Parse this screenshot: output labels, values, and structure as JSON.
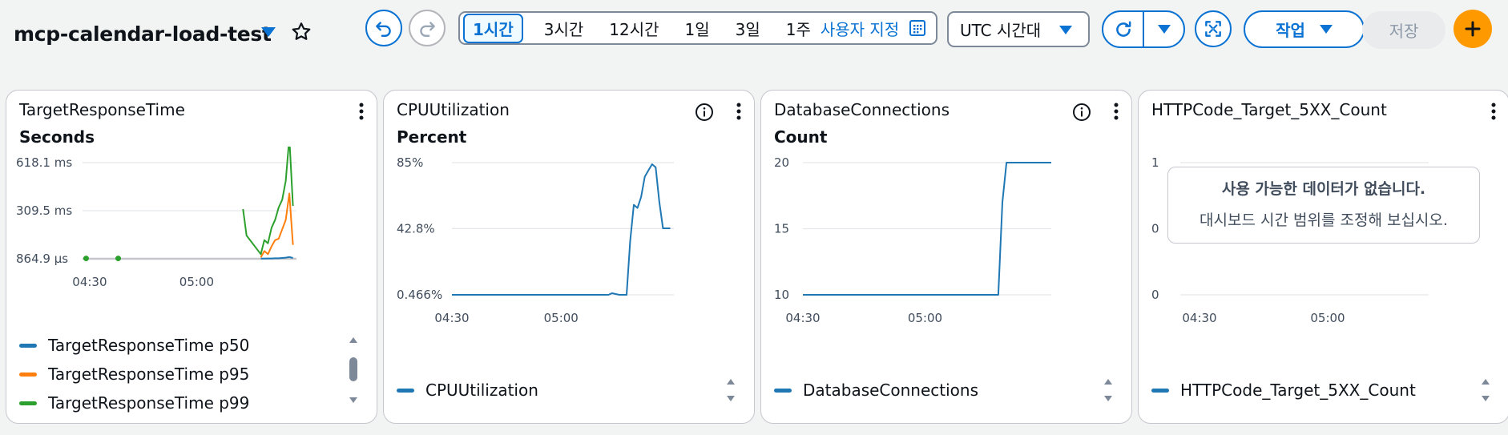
{
  "header": {
    "dashboard_title": "mcp-calendar-load-test",
    "time_ranges": [
      "1시간",
      "3시간",
      "12시간",
      "1일",
      "3일",
      "1주"
    ],
    "active_range": "1시간",
    "custom_range_label": "사용자 지정",
    "timezone_label": "UTC 시간대",
    "actions_label": "작업",
    "save_label": "저장"
  },
  "colors": {
    "accent": "#0972d3",
    "add": "#ff9900",
    "series_blue": "#1f77b4",
    "series_orange": "#ff7f0e",
    "series_green": "#2ca02c"
  },
  "icons": [
    "undo-icon",
    "redo-icon",
    "calendar-icon",
    "refresh-icon",
    "chevron-down-icon",
    "fullscreen-icon",
    "plus-icon",
    "star-icon",
    "info-icon",
    "more-icon"
  ],
  "widgets": [
    {
      "title": "TargetResponseTime",
      "unit": "Seconds",
      "legend": [
        "TargetResponseTime p50",
        "TargetResponseTime p95",
        "TargetResponseTime p99"
      ]
    },
    {
      "title": "CPUUtilization",
      "unit": "Percent",
      "legend": [
        "CPUUtilization"
      ]
    },
    {
      "title": "DatabaseConnections",
      "unit": "Count",
      "legend": [
        "DatabaseConnections"
      ]
    },
    {
      "title": "HTTPCode_Target_5XX_Count",
      "unit": "",
      "legend": [
        "HTTPCode_Target_5XX_Count"
      ],
      "no_data_title": "사용 가능한 데이터가 없습니다.",
      "no_data_hint": "대시보드 시간 범위를 조정해 보십시오."
    }
  ],
  "chart_data": [
    {
      "type": "line",
      "title": "TargetResponseTime",
      "ylabel": "Seconds",
      "ytick_labels": [
        "618.1 ms",
        "309.5 ms",
        "864.9 µs"
      ],
      "y_tick_values": [
        0.6181,
        0.3095,
        0.0008649
      ],
      "ylim": [
        0.0008649,
        0.6181
      ],
      "xtick_labels": [
        "04:30",
        "05:00"
      ],
      "x_tick_values": [
        270,
        300
      ],
      "xlim": [
        268,
        328
      ],
      "x_unit": "minutes since 00:00 UTC",
      "series": [
        {
          "name": "TargetResponseTime p50",
          "color": "#1f77b4",
          "x": [
            318,
            319,
            320,
            321,
            322,
            323,
            324,
            325,
            326,
            327
          ],
          "y": [
            0.002,
            0.002,
            0.003,
            0.003,
            0.004,
            0.004,
            0.006,
            0.008,
            0.012,
            0.006
          ]
        },
        {
          "name": "TargetResponseTime p95",
          "color": "#ff7f0e",
          "x": [
            318,
            319,
            320,
            321,
            322,
            323,
            324,
            325,
            326,
            327
          ],
          "y": [
            0.01,
            0.05,
            0.03,
            0.08,
            0.12,
            0.13,
            0.19,
            0.25,
            0.42,
            0.09
          ]
        },
        {
          "name": "TargetResponseTime p99",
          "color": "#2ca02c",
          "x": [
            313,
            314,
            318,
            319,
            320,
            321,
            322,
            323,
            324,
            325,
            326,
            327
          ],
          "y": [
            0.32,
            0.15,
            0.03,
            0.12,
            0.1,
            0.2,
            0.25,
            0.33,
            0.38,
            0.5,
            0.78,
            0.34
          ]
        }
      ],
      "markers_p99_x": [
        269,
        278
      ],
      "markers_p99_y": [
        0.003,
        0.003
      ]
    },
    {
      "type": "line",
      "title": "CPUUtilization",
      "ylabel": "Percent",
      "ytick_labels": [
        "85%",
        "42.8%",
        "0.466%"
      ],
      "y_tick_values": [
        85,
        42.8,
        0.466
      ],
      "ylim": [
        0.466,
        85
      ],
      "xtick_labels": [
        "04:30",
        "05:00"
      ],
      "x_tick_values": [
        270,
        300
      ],
      "xlim": [
        270,
        331
      ],
      "series": [
        {
          "name": "CPUUtilization",
          "color": "#1f77b4",
          "x": [
            270,
            300,
            313,
            314,
            316,
            317,
            318,
            319,
            320,
            321,
            322,
            323,
            324,
            325,
            326,
            327,
            328,
            329,
            330
          ],
          "y": [
            0.466,
            0.466,
            0.466,
            1.5,
            0.466,
            0.466,
            0.466,
            35,
            58,
            56,
            63,
            76,
            80,
            84,
            82,
            60,
            43,
            43,
            43
          ]
        }
      ]
    },
    {
      "type": "line",
      "title": "DatabaseConnections",
      "ylabel": "Count",
      "ytick_labels": [
        "20",
        "15",
        "10"
      ],
      "y_tick_values": [
        20,
        15,
        10
      ],
      "ylim": [
        10,
        20
      ],
      "xtick_labels": [
        "04:30",
        "05:00"
      ],
      "x_tick_values": [
        270,
        300
      ],
      "xlim": [
        270,
        331
      ],
      "series": [
        {
          "name": "DatabaseConnections",
          "color": "#1f77b4",
          "x": [
            270,
            318,
            319,
            320,
            321,
            325,
            331
          ],
          "y": [
            10,
            10,
            17,
            20,
            20,
            20,
            20
          ]
        }
      ]
    },
    {
      "type": "line",
      "title": "HTTPCode_Target_5XX_Count",
      "ytick_labels": [
        "1",
        "0",
        "0"
      ],
      "xtick_labels": [
        "04:30",
        "05:00"
      ],
      "series": []
    }
  ]
}
